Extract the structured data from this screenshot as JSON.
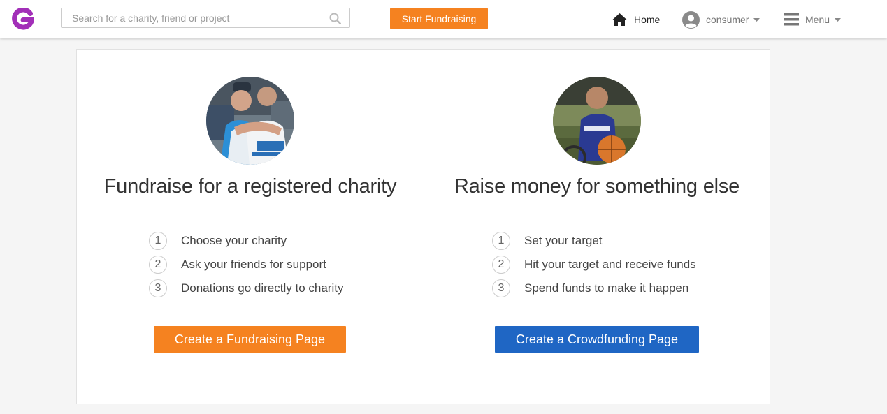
{
  "header": {
    "search_placeholder": "Search for a charity, friend or project",
    "start_button": "Start Fundraising",
    "nav": {
      "home": "Home",
      "user": "consumer",
      "menu": "Menu"
    }
  },
  "options": [
    {
      "title": "Fundraise for a registered charity",
      "steps": [
        {
          "num": "1",
          "text": "Choose your charity"
        },
        {
          "num": "2",
          "text": "Ask your friends for support"
        },
        {
          "num": "3",
          "text": "Donations go directly to charity"
        }
      ],
      "button": "Create a Fundraising Page"
    },
    {
      "title": "Raise money for something else",
      "steps": [
        {
          "num": "1",
          "text": "Set your target"
        },
        {
          "num": "2",
          "text": "Hit your target and receive funds"
        },
        {
          "num": "3",
          "text": "Spend funds to make it happen"
        }
      ],
      "button": "Create a Crowdfunding Page"
    }
  ],
  "colors": {
    "brand_purple": "#a22fb8",
    "accent_orange": "#f58220",
    "accent_blue": "#1f66c4"
  },
  "icons": [
    "logo-icon",
    "search-icon",
    "home-icon",
    "user-avatar-icon",
    "chevron-down-icon",
    "menu-icon"
  ]
}
